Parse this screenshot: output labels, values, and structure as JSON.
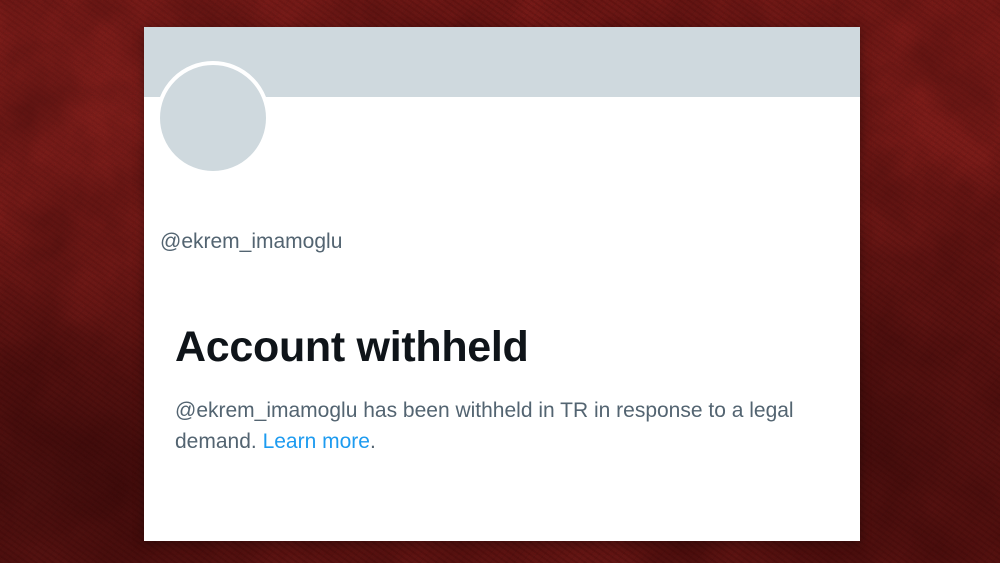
{
  "profile": {
    "handle": "@ekrem_imamoglu"
  },
  "notice": {
    "title": "Account withheld",
    "message": "@ekrem_imamoglu has been withheld in TR in response to a legal demand.",
    "link_label": "Learn more",
    "trailing_punctuation": "."
  },
  "colors": {
    "background": "#7a1512",
    "banner": "#cfd9de",
    "avatar": "#cfd9de",
    "title_text": "#0f1419",
    "secondary_text": "#536471",
    "link": "#1d9bf0"
  }
}
